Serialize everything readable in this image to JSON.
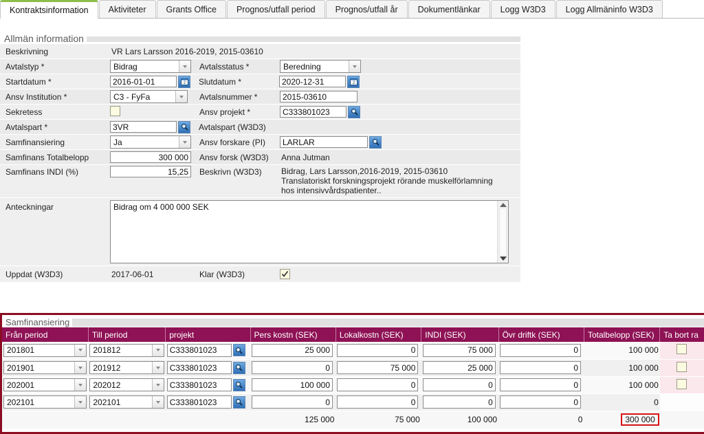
{
  "tabs": [
    {
      "label": "Kontraktsinformation",
      "active": true
    },
    {
      "label": "Aktiviteter",
      "active": false
    },
    {
      "label": "Grants Office",
      "active": false
    },
    {
      "label": "Prognos/utfall period",
      "active": false
    },
    {
      "label": "Prognos/utfall år",
      "active": false
    },
    {
      "label": "Dokumentlänkar",
      "active": false
    },
    {
      "label": "Logg W3D3",
      "active": false
    },
    {
      "label": "Logg Allmäninfo W3D3",
      "active": false
    }
  ],
  "general": {
    "section_title": "Allmän information",
    "beskrivning_label": "Beskrivning",
    "beskrivning_value": "VR Lars Larsson 2016-2019, 2015-03610",
    "avtalstyp_label": "Avtalstyp *",
    "avtalstyp_value": "Bidrag",
    "avtalsstatus_label": "Avtalsstatus *",
    "avtalsstatus_value": "Beredning",
    "startdatum_label": "Startdatum *",
    "startdatum_value": "2016-01-01",
    "slutdatum_label": "Slutdatum *",
    "slutdatum_value": "2020-12-31",
    "institution_label": "Ansv Institution *",
    "institution_value": "C3 - FyFa",
    "avtalsnummer_label": "Avtalsnummer *",
    "avtalsnummer_value": "2015-03610",
    "sekretess_label": "Sekretess",
    "sekretess_checked": false,
    "ansv_projekt_label": "Ansv projekt *",
    "ansv_projekt_value": "C333801023",
    "avtalspart_label": "Avtalspart *",
    "avtalspart_value": "3VR",
    "avtalspart_w3d3_label": "Avtalspart (W3D3)",
    "avtalspart_w3d3_value": "",
    "samfinansiering_label": "Samfinansiering",
    "samfinansiering_value": "Ja",
    "ansv_forskare_label": "Ansv forskare (PI)",
    "ansv_forskare_value": "LARLAR",
    "totalbelopp_label": "Samfinans Totalbelopp",
    "totalbelopp_value": "300 000",
    "ansv_forsk_w3d3_label": "Ansv forsk (W3D3)",
    "ansv_forsk_w3d3_value": "Anna Jutman",
    "indi_label": "Samfinans INDI (%)",
    "indi_value": "15,25",
    "beskrivn_w3d3_label": "Beskrivn (W3D3)",
    "beskrivn_w3d3_value": "Bidrag, Lars Larsson,2016-2019, 2015-03610\nTranslatoriskt forskningsprojekt rörande muskelförlamning\nhos intensivvårdspatienter..",
    "anteckningar_label": "Anteckningar",
    "anteckningar_value": "Bidrag om 4 000 000 SEK",
    "uppdat_label": "Uppdat (W3D3)",
    "uppdat_value": "2017-06-01",
    "klar_label": "Klar (W3D3)",
    "klar_checked": true
  },
  "cofinancing": {
    "section_title": "Samfinansiering",
    "columns": [
      "Från period",
      "Till period",
      "projekt",
      "Pers kostn (SEK)",
      "Lokalkostn (SEK)",
      "INDI (SEK)",
      "Övr driftk (SEK)",
      "Totalbelopp (SEK)",
      "Ta bort ra"
    ],
    "rows": [
      {
        "from": "201801",
        "to": "201812",
        "projekt": "C333801023",
        "pers": "25 000",
        "lokal": "0",
        "indi": "75 000",
        "ovr": "0",
        "total": "100 000",
        "delete_checked": false,
        "has_delete": true
      },
      {
        "from": "201901",
        "to": "201912",
        "projekt": "C333801023",
        "pers": "0",
        "lokal": "75 000",
        "indi": "25 000",
        "ovr": "0",
        "total": "100 000",
        "delete_checked": false,
        "has_delete": true
      },
      {
        "from": "202001",
        "to": "202012",
        "projekt": "C333801023",
        "pers": "100 000",
        "lokal": "0",
        "indi": "0",
        "ovr": "0",
        "total": "100 000",
        "delete_checked": false,
        "has_delete": true
      },
      {
        "from": "202101",
        "to": "202101",
        "projekt": "C333801023",
        "pers": "0",
        "lokal": "0",
        "indi": "0",
        "ovr": "0",
        "total": "0",
        "delete_checked": false,
        "has_delete": false
      }
    ],
    "totals": {
      "pers": "125 000",
      "lokal": "75 000",
      "indi": "100 000",
      "ovr": "0",
      "total": "300 000"
    }
  },
  "colors": {
    "grid_header": "#8e1255",
    "highlight_border": "#d61414",
    "panel_border": "#8b0d23",
    "active_tab_accent": "#8dbc4a"
  }
}
